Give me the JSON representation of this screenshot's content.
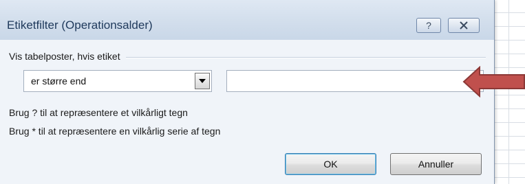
{
  "dialog": {
    "title": "Etiketfilter (Operationsalder)",
    "help_symbol": "?",
    "close_symbol": "✕"
  },
  "filter": {
    "group_label": "Vis tabelposter, hvis etiket",
    "operator_value": "er større end",
    "value_input": ""
  },
  "hints": {
    "line1": "Brug ? til at repræsentere et vilkårligt tegn",
    "line2": "Brug * til at repræsentere en vilkårlig serie af tegn"
  },
  "buttons": {
    "ok": "OK",
    "cancel": "Annuller"
  },
  "colors": {
    "arrow": "#c0504d",
    "arrow_outline": "#8c3836",
    "title_text": "#1e395b"
  }
}
